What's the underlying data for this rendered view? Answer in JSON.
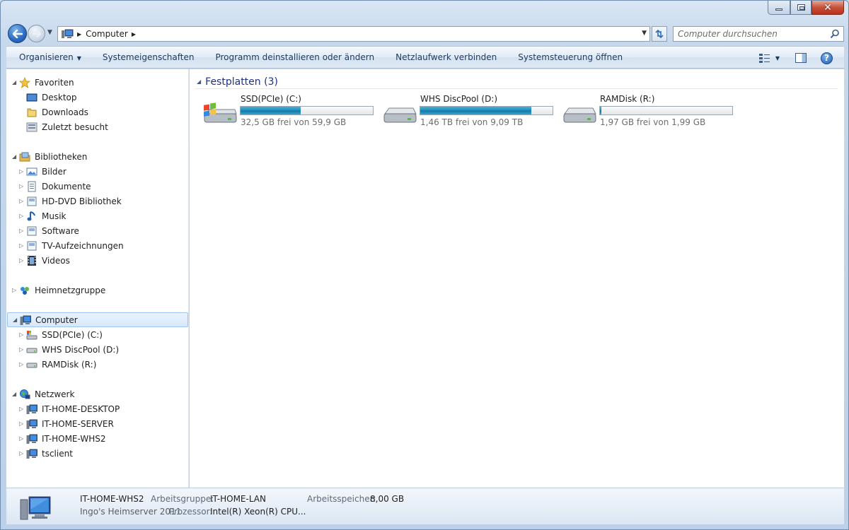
{
  "window": {
    "caption_buttons": {
      "minimize": "minimize",
      "maximize": "maximize",
      "close": "✕"
    }
  },
  "navbar": {
    "address": "Computer",
    "search_placeholder": "Computer durchsuchen"
  },
  "commandbar": {
    "items": [
      "Organisieren",
      "Systemeigenschaften",
      "Programm deinstallieren oder ändern",
      "Netzlaufwerk verbinden",
      "Systemsteuerung öffnen"
    ]
  },
  "navpane": {
    "favorites": {
      "label": "Favoriten",
      "items": [
        "Desktop",
        "Downloads",
        "Zuletzt besucht"
      ]
    },
    "libraries": {
      "label": "Bibliotheken",
      "items": [
        "Bilder",
        "Dokumente",
        "HD-DVD Bibliothek",
        "Musik",
        "Software",
        "TV-Aufzeichnungen",
        "Videos"
      ]
    },
    "homegroup": {
      "label": "Heimnetzgruppe"
    },
    "computer": {
      "label": "Computer",
      "items": [
        "SSD(PCIe) (C:)",
        "WHS DiscPool (D:)",
        "RAMDisk (R:)"
      ]
    },
    "network": {
      "label": "Netzwerk",
      "items": [
        "IT-HOME-DESKTOP",
        "IT-HOME-SERVER",
        "IT-HOME-WHS2",
        "tsclient"
      ]
    }
  },
  "content": {
    "group_title": "Festplatten (3)",
    "drives": [
      {
        "name": "SSD(PCIe) (C:)",
        "free": "32,5 GB frei von 59,9 GB",
        "used_fraction": 0.457
      },
      {
        "name": "WHS DiscPool (D:)",
        "free": "1,46 TB frei von 9,09 TB",
        "used_fraction": 0.84
      },
      {
        "name": "RAMDisk (R:)",
        "free": "1,97 GB frei von 1,99 GB",
        "used_fraction": 0.01
      }
    ]
  },
  "details": {
    "name": "IT-HOME-WHS2",
    "description": "Ingo's Heimserver 2011",
    "workgroup_label": "Arbeitsgruppe:",
    "workgroup_value": "IT-HOME-LAN",
    "memory_label": "Arbeitsspeicher:",
    "memory_value": "8,00 GB",
    "processor_label": "Prozessor:",
    "processor_value": "Intel(R) Xeon(R) CPU",
    "processor_more": "..."
  },
  "colors": {
    "accent": "#1e3287",
    "drive_bar": "#1f8bb8",
    "selection": "#d7e8fb"
  }
}
